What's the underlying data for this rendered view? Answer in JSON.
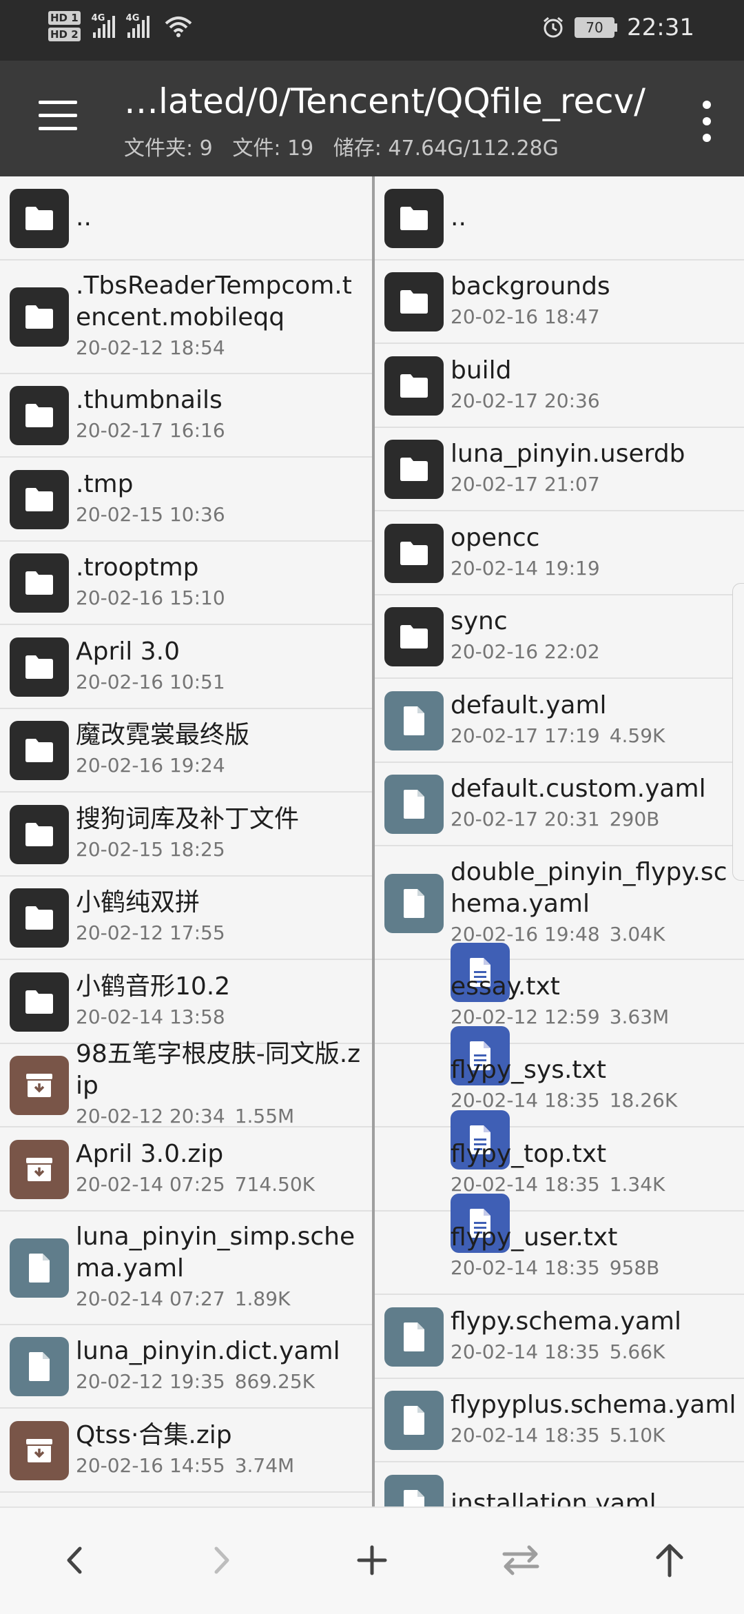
{
  "status_bar": {
    "hd1": "HD 1",
    "hd2": "HD 2",
    "sig1": "4G",
    "sig2": "4G",
    "battery": "70",
    "time": "22:31"
  },
  "app_bar": {
    "path": "…lated/0/Tencent/QQfile_recv/",
    "folders_label": "文件夹: 9",
    "files_label": "文件: 19",
    "storage_label": "储存: 47.64G/112.28G"
  },
  "left_pane": [
    {
      "type": "folder",
      "name": "..",
      "date": "",
      "size": ""
    },
    {
      "type": "folder",
      "name": ".TbsReaderTempcom.tencent.mobileqq",
      "date": "20-02-12 18:54",
      "size": ""
    },
    {
      "type": "folder",
      "name": ".thumbnails",
      "date": "20-02-17 16:16",
      "size": ""
    },
    {
      "type": "folder",
      "name": ".tmp",
      "date": "20-02-15 10:36",
      "size": ""
    },
    {
      "type": "folder",
      "name": ".trooptmp",
      "date": "20-02-16 15:10",
      "size": ""
    },
    {
      "type": "folder",
      "name": "April 3.0",
      "date": "20-02-16 10:51",
      "size": ""
    },
    {
      "type": "folder",
      "name": "魔改霓裳最终版",
      "date": "20-02-16 19:24",
      "size": ""
    },
    {
      "type": "folder",
      "name": "搜狗词库及补丁文件",
      "date": "20-02-15 18:25",
      "size": ""
    },
    {
      "type": "folder",
      "name": "小鹤纯双拼",
      "date": "20-02-12 17:55",
      "size": ""
    },
    {
      "type": "folder",
      "name": "小鹤音形10.2",
      "date": "20-02-14 13:58",
      "size": ""
    },
    {
      "type": "zip",
      "name": "98五笔字根皮肤-同文版.zip",
      "date": "20-02-12 20:34",
      "size": "1.55M"
    },
    {
      "type": "zip",
      "name": "April 3.0.zip",
      "date": "20-02-14 07:25",
      "size": "714.50K"
    },
    {
      "type": "file",
      "name": "luna_pinyin_simp.schema.yaml",
      "date": "20-02-14 07:27",
      "size": "1.89K"
    },
    {
      "type": "file",
      "name": "luna_pinyin.dict.yaml",
      "date": "20-02-12 19:35",
      "size": "869.25K"
    },
    {
      "type": "zip",
      "name": "Qtss·合集.zip",
      "date": "20-02-16 14:55",
      "size": "3.74M"
    }
  ],
  "right_pane": [
    {
      "type": "folder",
      "name": "..",
      "date": "",
      "size": ""
    },
    {
      "type": "folder",
      "name": "backgrounds",
      "date": "20-02-16 18:47",
      "size": ""
    },
    {
      "type": "folder",
      "name": "build",
      "date": "20-02-17 20:36",
      "size": ""
    },
    {
      "type": "folder",
      "name": "luna_pinyin.userdb",
      "date": "20-02-17 21:07",
      "size": ""
    },
    {
      "type": "folder",
      "name": "opencc",
      "date": "20-02-14 19:19",
      "size": ""
    },
    {
      "type": "folder",
      "name": "sync",
      "date": "20-02-16 22:02",
      "size": ""
    },
    {
      "type": "file",
      "name": "default.yaml",
      "date": "20-02-17 17:19",
      "size": "4.59K"
    },
    {
      "type": "file",
      "name": "default.custom.yaml",
      "date": "20-02-17 20:31",
      "size": "290B"
    },
    {
      "type": "file",
      "name": "double_pinyin_flypy.schema.yaml",
      "date": "20-02-16 19:48",
      "size": "3.04K"
    },
    {
      "type": "text",
      "name": "essay.txt",
      "date": "20-02-12 12:59",
      "size": "3.63M"
    },
    {
      "type": "text",
      "name": "flypy_sys.txt",
      "date": "20-02-14 18:35",
      "size": "18.26K"
    },
    {
      "type": "text",
      "name": "flypy_top.txt",
      "date": "20-02-14 18:35",
      "size": "1.34K"
    },
    {
      "type": "text",
      "name": "flypy_user.txt",
      "date": "20-02-14 18:35",
      "size": "958B"
    },
    {
      "type": "file",
      "name": "flypy.schema.yaml",
      "date": "20-02-14 18:35",
      "size": "5.66K"
    },
    {
      "type": "file",
      "name": "flypyplus.schema.yaml",
      "date": "20-02-14 18:35",
      "size": "5.10K"
    },
    {
      "type": "file",
      "name": "installation.yaml",
      "date": "",
      "size": ""
    }
  ],
  "bottom_bar": {
    "back": "back-icon",
    "forward": "forward-icon",
    "add": "add-icon",
    "swap": "swap-icon",
    "up": "up-icon"
  }
}
